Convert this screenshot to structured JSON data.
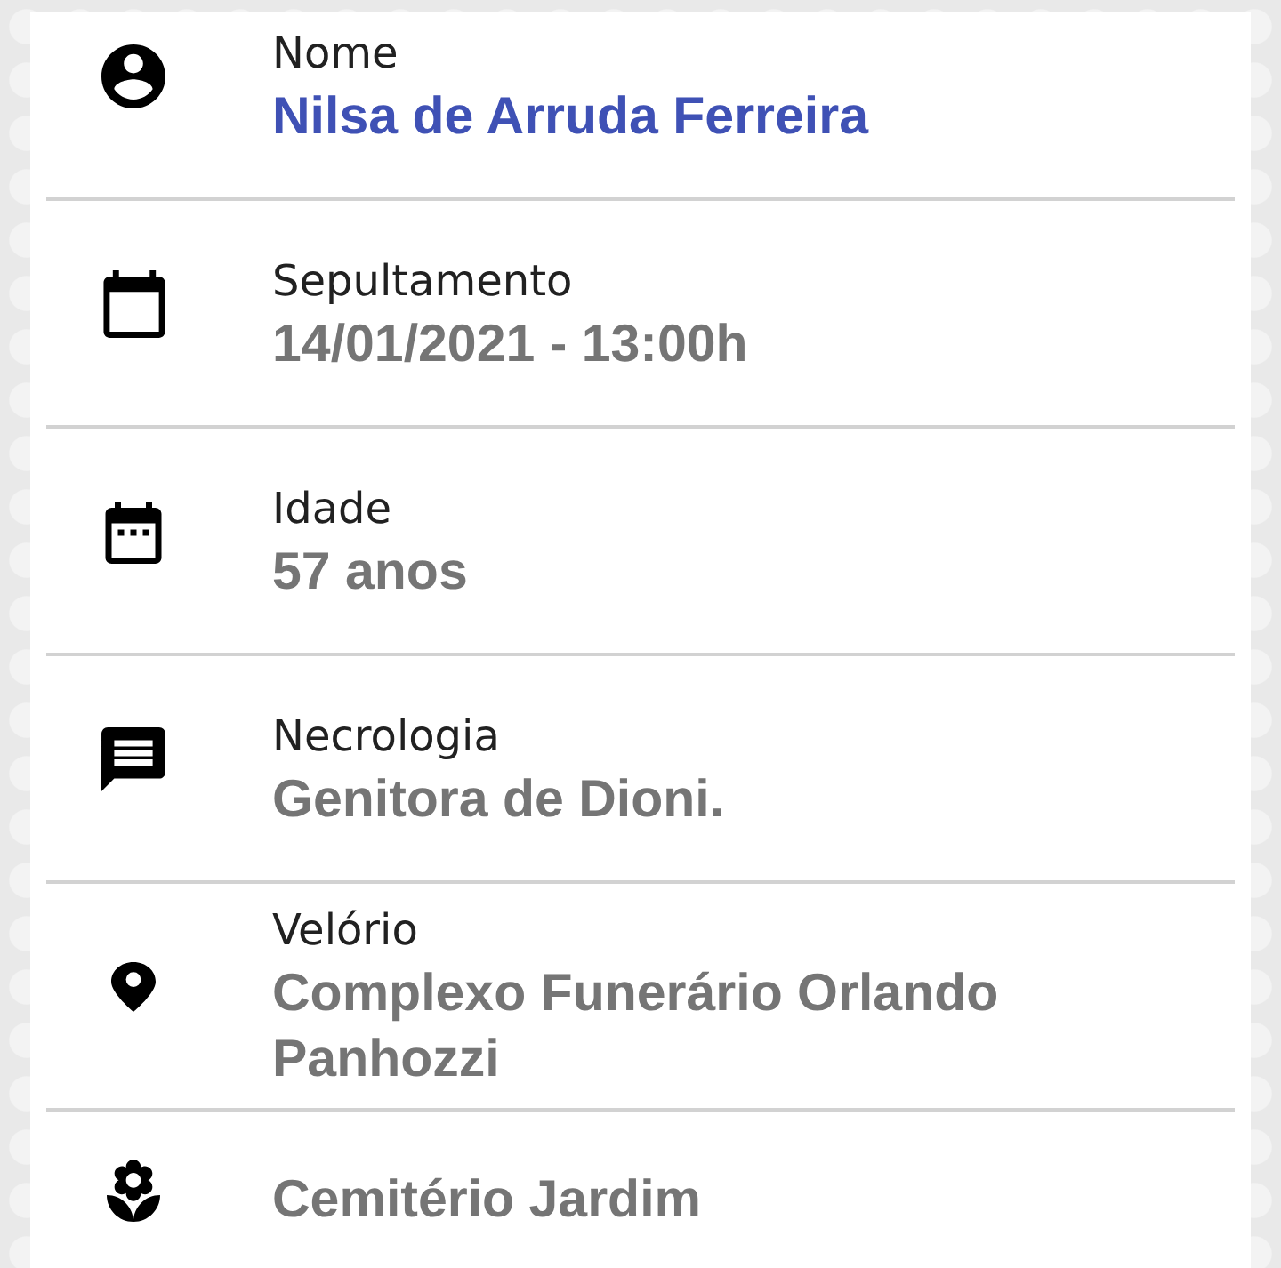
{
  "rows": [
    {
      "kind": "name",
      "label": "Nome",
      "value": "Nilsa de Arruda Ferreira"
    },
    {
      "kind": "burial",
      "label": "Sepultamento",
      "value": "14/01/2021 - 13:00h"
    },
    {
      "kind": "age",
      "label": "Idade",
      "value": "57 anos"
    },
    {
      "kind": "obituary",
      "label": "Necrologia",
      "value": "Genitora de Dioni."
    },
    {
      "kind": "wake",
      "label": "Velório",
      "value": "Complexo Funerário Orlando Panhozzi"
    },
    {
      "kind": "cemetery",
      "value": "Cemitério Jardim"
    }
  ]
}
